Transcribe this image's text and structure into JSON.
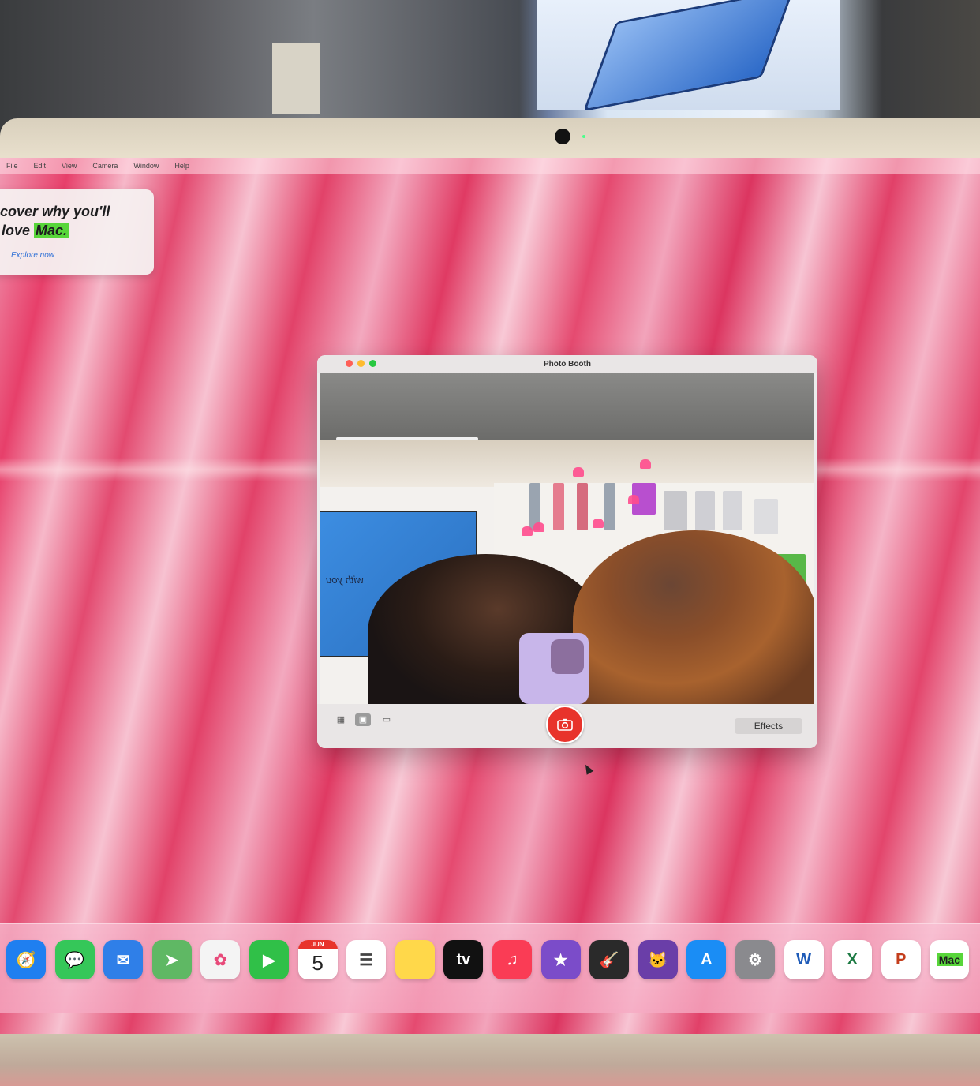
{
  "menubar": {
    "items": [
      "File",
      "Edit",
      "View",
      "Camera",
      "Window",
      "Help"
    ]
  },
  "notification": {
    "line1": "cover why you'll",
    "line2_prefix": "love ",
    "line2_highlight": "Mac.",
    "link": "Explore now"
  },
  "photo_booth": {
    "title": "Photo Booth",
    "photo_caption": "with you",
    "view_modes": [
      "grid-view-icon",
      "single-photo-icon",
      "video-icon"
    ],
    "selected_view_mode": 1,
    "shutter_icon": "camera-icon",
    "effects_label": "Effects"
  },
  "dock": {
    "apps": [
      {
        "name": "safari",
        "icon": "safari-icon",
        "color": "#1f7ff0"
      },
      {
        "name": "messages",
        "icon": "messages-icon",
        "color": "#35c759"
      },
      {
        "name": "mail",
        "icon": "mail-icon",
        "color": "#2f7fe8"
      },
      {
        "name": "maps",
        "icon": "maps-icon",
        "color": "#5fb864"
      },
      {
        "name": "photos",
        "icon": "photos-icon",
        "color": "#f4f4f4"
      },
      {
        "name": "facetime",
        "icon": "facetime-icon",
        "color": "#30c048"
      },
      {
        "name": "calendar",
        "icon": "calendar-icon",
        "color": "#ffffff",
        "month": "JUN",
        "day": "5"
      },
      {
        "name": "reminders",
        "icon": "reminders-icon",
        "color": "#ffffff"
      },
      {
        "name": "notes",
        "icon": "notes-icon",
        "color": "#ffd84a"
      },
      {
        "name": "apple-tv",
        "icon": "tv-icon",
        "color": "#111111",
        "label": "tv"
      },
      {
        "name": "music",
        "icon": "music-icon",
        "color": "#fa3c55"
      },
      {
        "name": "imovie",
        "icon": "imovie-icon",
        "color": "#7b4cc9"
      },
      {
        "name": "garageband",
        "icon": "garageband-icon",
        "color": "#2a2a2a"
      },
      {
        "name": "memoji",
        "icon": "cat-icon",
        "color": "#6a3ea8"
      },
      {
        "name": "app-store",
        "icon": "app-store-icon",
        "color": "#1a8df5"
      },
      {
        "name": "system-settings",
        "icon": "gear-icon",
        "color": "#8a8a8e"
      },
      {
        "name": "word",
        "icon": "word-icon",
        "color": "#ffffff",
        "label": "W"
      },
      {
        "name": "excel",
        "icon": "excel-icon",
        "color": "#ffffff",
        "label": "X"
      },
      {
        "name": "powerpoint",
        "icon": "powerpoint-icon",
        "color": "#ffffff",
        "label": "P"
      },
      {
        "name": "mac-tips",
        "icon": "mac-icon",
        "color": "#ffffff",
        "label": "Mac"
      }
    ]
  }
}
